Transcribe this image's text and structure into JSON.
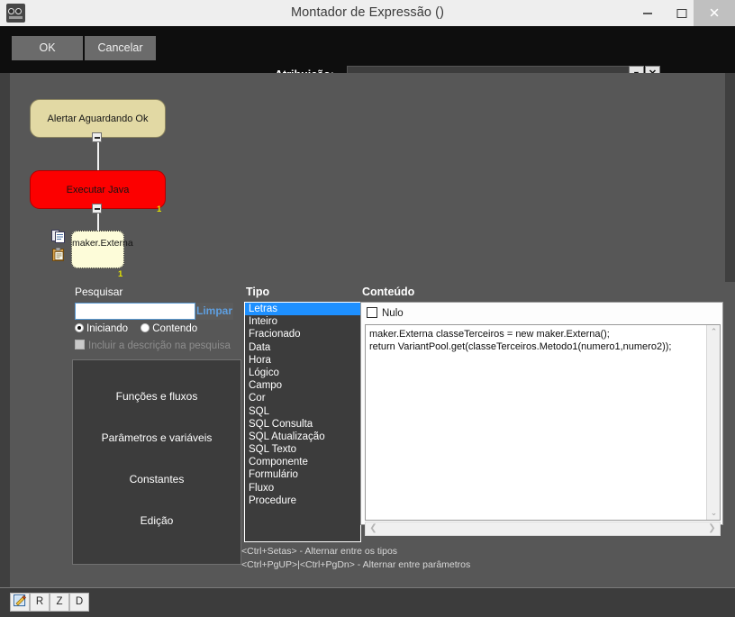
{
  "window": {
    "title": "Montador de Expressão ()",
    "app_icon": "goggles-icon",
    "controls": {
      "minimize": "minimize-icon",
      "maximize": "maximize-icon",
      "close": "✕"
    }
  },
  "toolbar": {
    "ok_label": "OK",
    "cancel_label": "Cancelar",
    "attribution_label": "Atribuição:",
    "attribution_value": "",
    "attribution_placeholder": "",
    "dropdown_glyph": "▼",
    "clear_glyph": "✕"
  },
  "flow": {
    "nodes": [
      {
        "label": "Alertar Aguardando Ok",
        "color": "#e2d9a4"
      },
      {
        "label": "Executar Java",
        "color": "#fc0000",
        "count": "1"
      },
      {
        "label": "maker.Externa",
        "color": "#fdfcd9",
        "count": "1"
      }
    ],
    "icons": [
      "copy-icon",
      "paste-icon"
    ]
  },
  "search": {
    "label": "Pesquisar",
    "value": "",
    "placeholder": "",
    "clear_label": "Limpar",
    "options": [
      {
        "label": "Iniciando",
        "selected": true
      },
      {
        "label": "Contendo",
        "selected": false
      }
    ],
    "include_description_label": "Incluir a descrição na pesquisa",
    "include_description_checked": false,
    "include_description_disabled": true
  },
  "accordion": {
    "items": [
      {
        "label": "Funções e fluxos"
      },
      {
        "label": "Parâmetros e variáveis"
      },
      {
        "label": "Constantes"
      },
      {
        "label": "Edição"
      }
    ]
  },
  "tipo": {
    "header": "Tipo",
    "selected_index": 0,
    "items": [
      "Letras",
      "Inteiro",
      "Fracionado",
      "Data",
      "Hora",
      "Lógico",
      "Campo",
      "Cor",
      "SQL",
      "SQL Consulta",
      "SQL Atualização",
      "SQL Texto",
      "Componente",
      "Formulário",
      "Fluxo",
      "Procedure"
    ],
    "highlight_color": "#1e90ff"
  },
  "conteudo": {
    "header": "Conteúdo",
    "null_label": "Nulo",
    "null_checked": false,
    "code": "maker.Externa classeTerceiros = new maker.Externa();\nreturn VariantPool.get(classeTerceiros.Metodo1(numero1,numero2));",
    "scroll_up_glyph": "⌃",
    "scroll_down_glyph": "⌄",
    "scroll_left_glyph": "❮",
    "scroll_right_glyph": "❯"
  },
  "hints": {
    "line1": "<Ctrl+Setas> - Alternar entre os tipos",
    "line2": "<Ctrl+PgUP>|<Ctrl+PgDn> - Alternar entre parâmetros"
  },
  "taskbar": {
    "buttons": [
      {
        "label": "",
        "icon": "edit-pencil-icon"
      },
      {
        "label": "R",
        "icon": ""
      },
      {
        "label": "Z",
        "icon": ""
      },
      {
        "label": "D",
        "icon": ""
      }
    ]
  }
}
